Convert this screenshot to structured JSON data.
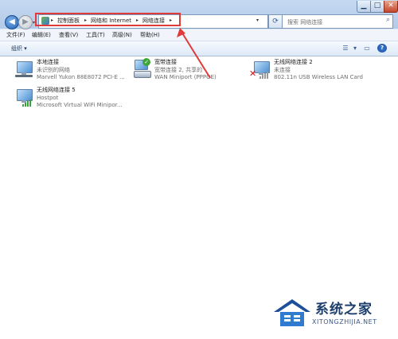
{
  "window": {
    "controls": {
      "minimize": "▁",
      "maximize": "□",
      "close": "✕"
    }
  },
  "nav": {
    "address": {
      "crumbs": [
        "控制面板",
        "网络和 Internet",
        "网络连接"
      ]
    },
    "search": {
      "placeholder": "搜索 网络连接"
    }
  },
  "menubar": {
    "items": [
      "文件(F)",
      "编辑(E)",
      "查看(V)",
      "工具(T)",
      "高级(N)",
      "帮助(H)"
    ]
  },
  "toolbar": {
    "organize_label": "组织 ▾"
  },
  "connections": [
    {
      "name": "本地连接",
      "status": "未识别的网络",
      "device": "Marvell Yukon 88E8072 PCI-E ...",
      "icon": "wired-network-icon"
    },
    {
      "name": "宽带连接",
      "status": "宽带连接 2, 共享的",
      "device": "WAN Miniport (PPPOE)",
      "icon": "broadband-connected-icon"
    },
    {
      "name": "无线网络连接 2",
      "status": "未连接",
      "device": "802.11n USB Wireless LAN Card",
      "icon": "wireless-disconnected-icon"
    },
    {
      "name": "无线网络连接 5",
      "status": "Hostpot",
      "device": "Microsoft Virtual WiFi Minipor...",
      "icon": "wireless-network-icon"
    }
  ],
  "watermark": {
    "brand": "系统之家",
    "url": "XITONGZHIJIA.NET"
  },
  "colors": {
    "annotation": "#e03a3a",
    "signal": "#3aa33a",
    "accent": "#1f5fb3"
  }
}
